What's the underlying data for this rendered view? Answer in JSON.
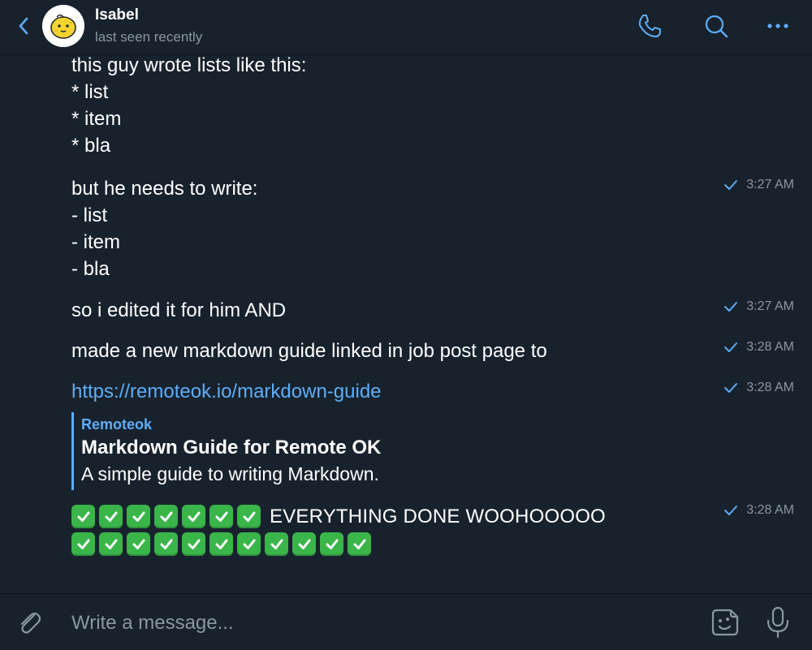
{
  "header": {
    "contact_name": "Isabel",
    "contact_status": "last seen recently",
    "icons": [
      "back-chevron-icon",
      "phone-icon",
      "search-icon",
      "more-icon"
    ]
  },
  "colors": {
    "background": "#18222d",
    "accent": "#5eadf6",
    "muted": "#8b96a3",
    "check_emoji": "#3ab54a"
  },
  "messages": [
    {
      "text": "this guy wrote lists like this:\n* list\n* item\n* bla",
      "time": ""
    },
    {
      "text": "but he needs to write:\n- list\n- item\n- bla",
      "time": "3:27 AM"
    },
    {
      "text": "so i edited it for him AND",
      "time": "3:27 AM"
    },
    {
      "text": "made a new markdown guide linked in job post page to",
      "time": "3:28 AM"
    },
    {
      "link": "https://remoteok.io/markdown-guide",
      "time": "3:28 AM",
      "preview": {
        "site": "Remoteok",
        "title": "Markdown Guide for Remote OK",
        "description": "A simple guide to writing Markdown."
      }
    },
    {
      "emoji": "white-check-mark",
      "emoji_count_line1": 7,
      "text": "EVERYTHING DONE WOOHOOOOO",
      "emoji_count_line2": 11,
      "time": "3:28 AM"
    }
  ],
  "composer": {
    "placeholder": "Write a message..."
  }
}
